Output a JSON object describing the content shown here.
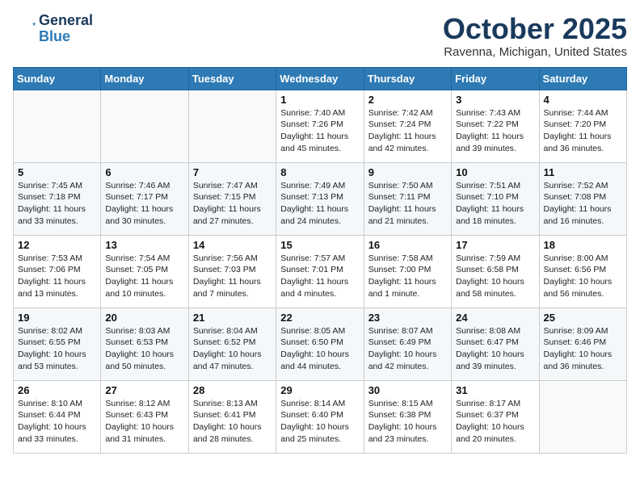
{
  "header": {
    "logo_line1": "General",
    "logo_line2": "Blue",
    "month": "October 2025",
    "location": "Ravenna, Michigan, United States"
  },
  "days_of_week": [
    "Sunday",
    "Monday",
    "Tuesday",
    "Wednesday",
    "Thursday",
    "Friday",
    "Saturday"
  ],
  "weeks": [
    [
      {
        "day": "",
        "info": ""
      },
      {
        "day": "",
        "info": ""
      },
      {
        "day": "",
        "info": ""
      },
      {
        "day": "1",
        "info": "Sunrise: 7:40 AM\nSunset: 7:26 PM\nDaylight: 11 hours\nand 45 minutes."
      },
      {
        "day": "2",
        "info": "Sunrise: 7:42 AM\nSunset: 7:24 PM\nDaylight: 11 hours\nand 42 minutes."
      },
      {
        "day": "3",
        "info": "Sunrise: 7:43 AM\nSunset: 7:22 PM\nDaylight: 11 hours\nand 39 minutes."
      },
      {
        "day": "4",
        "info": "Sunrise: 7:44 AM\nSunset: 7:20 PM\nDaylight: 11 hours\nand 36 minutes."
      }
    ],
    [
      {
        "day": "5",
        "info": "Sunrise: 7:45 AM\nSunset: 7:18 PM\nDaylight: 11 hours\nand 33 minutes."
      },
      {
        "day": "6",
        "info": "Sunrise: 7:46 AM\nSunset: 7:17 PM\nDaylight: 11 hours\nand 30 minutes."
      },
      {
        "day": "7",
        "info": "Sunrise: 7:47 AM\nSunset: 7:15 PM\nDaylight: 11 hours\nand 27 minutes."
      },
      {
        "day": "8",
        "info": "Sunrise: 7:49 AM\nSunset: 7:13 PM\nDaylight: 11 hours\nand 24 minutes."
      },
      {
        "day": "9",
        "info": "Sunrise: 7:50 AM\nSunset: 7:11 PM\nDaylight: 11 hours\nand 21 minutes."
      },
      {
        "day": "10",
        "info": "Sunrise: 7:51 AM\nSunset: 7:10 PM\nDaylight: 11 hours\nand 18 minutes."
      },
      {
        "day": "11",
        "info": "Sunrise: 7:52 AM\nSunset: 7:08 PM\nDaylight: 11 hours\nand 16 minutes."
      }
    ],
    [
      {
        "day": "12",
        "info": "Sunrise: 7:53 AM\nSunset: 7:06 PM\nDaylight: 11 hours\nand 13 minutes."
      },
      {
        "day": "13",
        "info": "Sunrise: 7:54 AM\nSunset: 7:05 PM\nDaylight: 11 hours\nand 10 minutes."
      },
      {
        "day": "14",
        "info": "Sunrise: 7:56 AM\nSunset: 7:03 PM\nDaylight: 11 hours\nand 7 minutes."
      },
      {
        "day": "15",
        "info": "Sunrise: 7:57 AM\nSunset: 7:01 PM\nDaylight: 11 hours\nand 4 minutes."
      },
      {
        "day": "16",
        "info": "Sunrise: 7:58 AM\nSunset: 7:00 PM\nDaylight: 11 hours\nand 1 minute."
      },
      {
        "day": "17",
        "info": "Sunrise: 7:59 AM\nSunset: 6:58 PM\nDaylight: 10 hours\nand 58 minutes."
      },
      {
        "day": "18",
        "info": "Sunrise: 8:00 AM\nSunset: 6:56 PM\nDaylight: 10 hours\nand 56 minutes."
      }
    ],
    [
      {
        "day": "19",
        "info": "Sunrise: 8:02 AM\nSunset: 6:55 PM\nDaylight: 10 hours\nand 53 minutes."
      },
      {
        "day": "20",
        "info": "Sunrise: 8:03 AM\nSunset: 6:53 PM\nDaylight: 10 hours\nand 50 minutes."
      },
      {
        "day": "21",
        "info": "Sunrise: 8:04 AM\nSunset: 6:52 PM\nDaylight: 10 hours\nand 47 minutes."
      },
      {
        "day": "22",
        "info": "Sunrise: 8:05 AM\nSunset: 6:50 PM\nDaylight: 10 hours\nand 44 minutes."
      },
      {
        "day": "23",
        "info": "Sunrise: 8:07 AM\nSunset: 6:49 PM\nDaylight: 10 hours\nand 42 minutes."
      },
      {
        "day": "24",
        "info": "Sunrise: 8:08 AM\nSunset: 6:47 PM\nDaylight: 10 hours\nand 39 minutes."
      },
      {
        "day": "25",
        "info": "Sunrise: 8:09 AM\nSunset: 6:46 PM\nDaylight: 10 hours\nand 36 minutes."
      }
    ],
    [
      {
        "day": "26",
        "info": "Sunrise: 8:10 AM\nSunset: 6:44 PM\nDaylight: 10 hours\nand 33 minutes."
      },
      {
        "day": "27",
        "info": "Sunrise: 8:12 AM\nSunset: 6:43 PM\nDaylight: 10 hours\nand 31 minutes."
      },
      {
        "day": "28",
        "info": "Sunrise: 8:13 AM\nSunset: 6:41 PM\nDaylight: 10 hours\nand 28 minutes."
      },
      {
        "day": "29",
        "info": "Sunrise: 8:14 AM\nSunset: 6:40 PM\nDaylight: 10 hours\nand 25 minutes."
      },
      {
        "day": "30",
        "info": "Sunrise: 8:15 AM\nSunset: 6:38 PM\nDaylight: 10 hours\nand 23 minutes."
      },
      {
        "day": "31",
        "info": "Sunrise: 8:17 AM\nSunset: 6:37 PM\nDaylight: 10 hours\nand 20 minutes."
      },
      {
        "day": "",
        "info": ""
      }
    ]
  ]
}
